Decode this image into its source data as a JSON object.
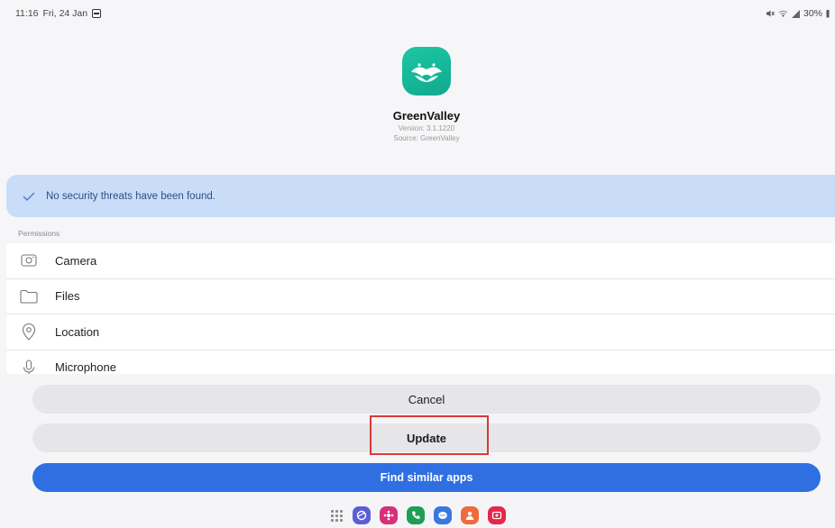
{
  "status_bar": {
    "time": "11:16",
    "date": "Fri, 24 Jan",
    "battery": "30%"
  },
  "app": {
    "name": "GreenValley",
    "version": "Version: 3.1.1220",
    "source": "Source: GreenValley",
    "icon": "greenvalley-app-icon",
    "icon_color": "#16b898"
  },
  "security": {
    "message": "No security threats have been found.",
    "icon": "check-icon",
    "background": "#c9ddf9"
  },
  "permissions": {
    "label": "Permissions",
    "items": [
      {
        "label": "Camera",
        "icon": "camera-icon"
      },
      {
        "label": "Files",
        "icon": "folder-icon"
      },
      {
        "label": "Location",
        "icon": "location-pin-icon"
      },
      {
        "label": "Microphone",
        "icon": "microphone-icon"
      }
    ]
  },
  "actions": {
    "cancel_label": "Cancel",
    "update_label": "Update",
    "find_similar_label": "Find similar apps",
    "primary_color": "#2f6fe2"
  },
  "dock": {
    "icons": [
      "app-drawer-icon",
      "internet-icon",
      "galaxy-store-icon",
      "phone-icon",
      "messages-icon",
      "contacts-icon",
      "screen-recorder-icon"
    ]
  }
}
